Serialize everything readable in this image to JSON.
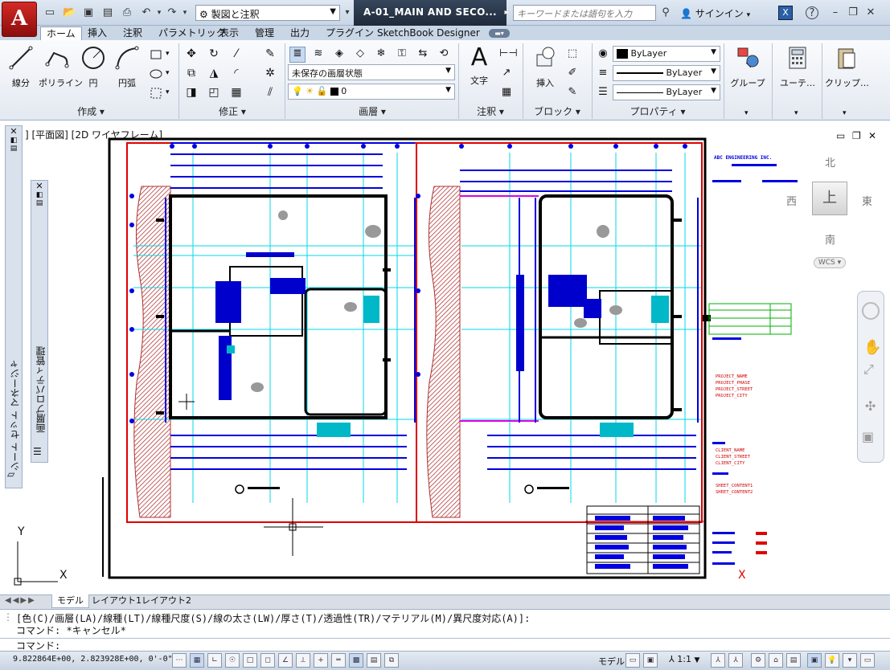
{
  "app": {
    "logo_letter": "A"
  },
  "titlebar": {
    "workspace": "製図と注釈",
    "document_title": "A-01_MAIN AND SECO...",
    "search_placeholder": "キーワードまたは語句を入力",
    "signin": "サインイン"
  },
  "tabs": [
    "ホーム",
    "挿入",
    "注釈",
    "パラメトリック",
    "表示",
    "管理",
    "出力",
    "プラグイン",
    "SketchBook Designer"
  ],
  "ribbon": {
    "draw_tools": [
      "線分",
      "ポリライン",
      "円",
      "円弧"
    ],
    "panels": {
      "draw": "作成",
      "modify": "修正",
      "layer": "画層",
      "annotation": "注釈",
      "block": "ブロック",
      "properties": "プロパティ"
    },
    "layer_state": "未保存の画層状態",
    "current_layer": "0",
    "text_tool": "文字",
    "insert_tool": "挿入",
    "color": "ByLayer",
    "linetype": "ByLayer",
    "lineweight": "ByLayer",
    "group_tool": "グループ",
    "utilities_tool": "ユーテ…",
    "clipboard_tool": "クリップ…"
  },
  "palettes": {
    "sheet_set": "シート セット マネージャ",
    "layer_props": "画層プロパティ管理"
  },
  "viewport": {
    "label": "] [平面図] [2D ワイヤフレーム]",
    "compass": {
      "north": "北",
      "south": "南",
      "east": "東",
      "west": "西",
      "top": "上",
      "wcs": "WCS"
    },
    "ucs": {
      "x": "X",
      "y": "Y"
    },
    "sheet_labels": [
      "PROJECT_NAME",
      "PROJECT_PHASE",
      "PROJECT_STREET",
      "PROJECT_CITY",
      "CLIENT_NAME",
      "CLIENT_STREET",
      "CLIENT_CITY",
      "SHEET_CONTENT1",
      "SHEET_CONTENT2"
    ],
    "firm_name": "ABC ENGINEERING INC."
  },
  "layout_tabs": [
    "モデル",
    "レイアウト1",
    "レイアウト2"
  ],
  "command": {
    "history1": "[色(C)/画層(LA)/線種(LT)/線種尺度(S)/線の太さ(LW)/厚さ(T)/透過性(TR)/マテリアル(M)/異尺度対応(A)]:",
    "history2": "コマンド: *キャンセル*",
    "prompt": "コマンド:"
  },
  "status": {
    "coords": "9.822864E+00, 2.823928E+00, 0'-0\"",
    "model": "モデル",
    "scale": "1:1"
  }
}
